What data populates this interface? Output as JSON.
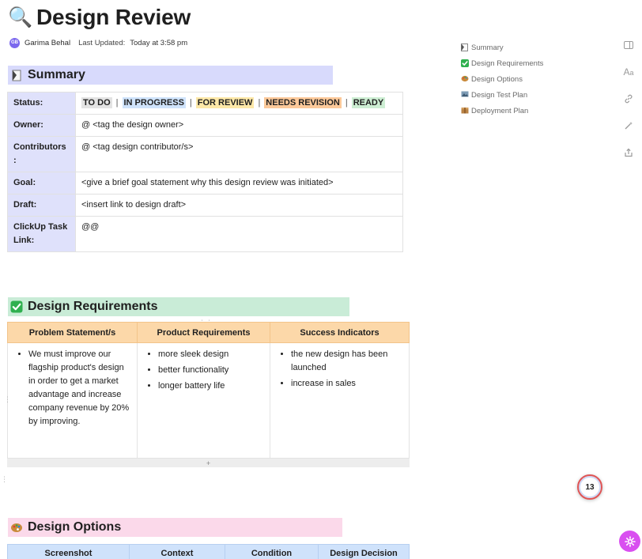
{
  "page": {
    "title": "Design Review",
    "title_icon": "magnifying-glass-icon"
  },
  "meta": {
    "avatar_initials": "GB",
    "author": "Garima Behal",
    "updated_label": "Last Updated:",
    "updated_value": "Today at 3:58 pm"
  },
  "colors": {
    "summary_heading_bg": "#d8dafc",
    "requirements_heading_bg": "#c9ecd7",
    "options_heading_bg": "#fbd9ea",
    "key_column_bg": "#dfe1fb",
    "requirements_header_bg": "#fcd8a9",
    "options_header_bg": "#cfe2fb",
    "status_todo_bg": "#e3e3e3",
    "status_inprogress_bg": "#cfe3fb",
    "status_forreview_bg": "#fde8a8",
    "status_needsrevision_bg": "#fcc99a",
    "status_ready_bg": "#cdeed3",
    "fab_color": "#d94ff0"
  },
  "summary": {
    "heading": "Summary",
    "heading_icon": "page-icon",
    "rows": {
      "status_label": "Status:",
      "statuses": [
        "TO DO",
        "IN PROGRESS",
        "FOR REVIEW",
        "NEEDS REVISION",
        "READY"
      ],
      "status_separator": "|",
      "owner_label": "Owner:",
      "owner_value": "@ <tag the design owner>",
      "contributors_label": "Contributors :",
      "contributors_value": "@ <tag design contributor/s>",
      "goal_label": "Goal:",
      "goal_value": "<give a brief goal statement why this design review was initiated>",
      "draft_label": "Draft:",
      "draft_value": "<insert link to design draft>",
      "task_label": "ClickUp Task Link:",
      "task_value": "@@"
    }
  },
  "requirements": {
    "heading": "Design Requirements",
    "heading_icon": "check-mark-icon",
    "columns": [
      "Problem Statement/s",
      "Product Requirements",
      "Success Indicators"
    ],
    "problems": [
      "We must improve our flagship product's design in order to get a market advantage and increase company revenue by 20% by improving."
    ],
    "product_requirements": [
      "more sleek design",
      "better functionality",
      "longer battery life"
    ],
    "success_indicators": [
      "the new design has been launched",
      "increase in sales"
    ],
    "add_row_symbol": "+"
  },
  "options": {
    "heading": "Design Options",
    "heading_icon": "palette-icon",
    "columns": [
      "Screenshot",
      "Context",
      "Condition",
      "Design Decision"
    ]
  },
  "toc": {
    "items": [
      {
        "label": "Summary",
        "icon": "page-icon"
      },
      {
        "label": "Design Requirements",
        "icon": "check-mark-icon"
      },
      {
        "label": "Design Options",
        "icon": "palette-icon"
      },
      {
        "label": "Design Test Plan",
        "icon": "image-icon"
      },
      {
        "label": "Deployment Plan",
        "icon": "package-icon"
      }
    ]
  },
  "rail": {
    "icons": [
      "sidebar-toggle-icon",
      "font-size-icon",
      "link-icon",
      "magic-wand-icon",
      "share-icon"
    ]
  },
  "badge": {
    "count": "13"
  }
}
